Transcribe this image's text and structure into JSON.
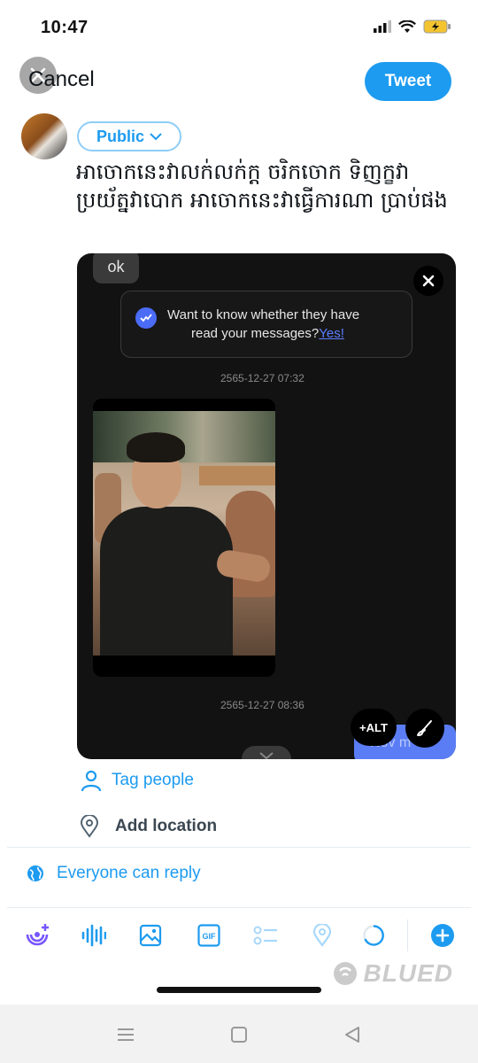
{
  "status_bar": {
    "time": "10:47"
  },
  "header": {
    "cancel_label": "Cancel",
    "tweet_label": "Tweet"
  },
  "composer": {
    "audience_label": "Public",
    "text": "អាចោកនេះវាលក់លក់ក្ត ចរិកចោក ទិញក្ខវា ប្រយ័ត្នវាបោក អាចោកនេះវាធ្វើការណា ប្រាប់ផង"
  },
  "media": {
    "ok_text": "ok",
    "notice_line1": "Want to know whether they have",
    "notice_line2": "read your messages?",
    "notice_link": "Yes!",
    "timestamp1": "2565-12-27 07:32",
    "timestamp2": "2565-12-27 08:36",
    "alt_label": "+ALT",
    "partial_bubble_text": "Nov m"
  },
  "actions": {
    "tag_people": "Tag people",
    "add_location": "Add location",
    "reply_setting": "Everyone can reply"
  },
  "watermark": "BLUED",
  "colors": {
    "accent": "#1d9bf0",
    "dark_media": "#121212",
    "notice_link": "#5b7cff"
  }
}
